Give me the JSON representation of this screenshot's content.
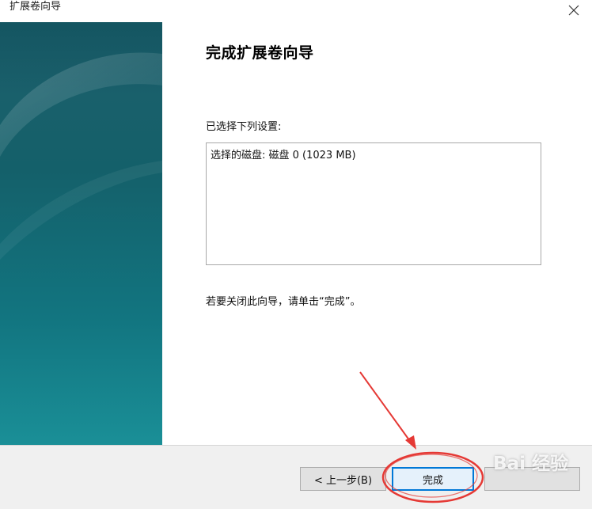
{
  "window": {
    "title": "扩展卷向导"
  },
  "content": {
    "heading": "完成扩展卷向导",
    "settings_label": "已选择下列设置:",
    "settings_text": "选择的磁盘: 磁盘 0 (1023 MB)",
    "close_hint": "若要关闭此向导，请单击“完成”。"
  },
  "footer": {
    "back_label": "< 上一步(B)",
    "finish_label": "完成",
    "cancel_label": ""
  },
  "watermark": {
    "text": "Bai 经验"
  },
  "icons": {
    "close": "close-icon"
  },
  "colors": {
    "side_panel_top": "#1e5f6c",
    "side_panel_bottom": "#1a8f97",
    "annotation_red": "#e53935",
    "focus_blue": "#0078d7"
  }
}
